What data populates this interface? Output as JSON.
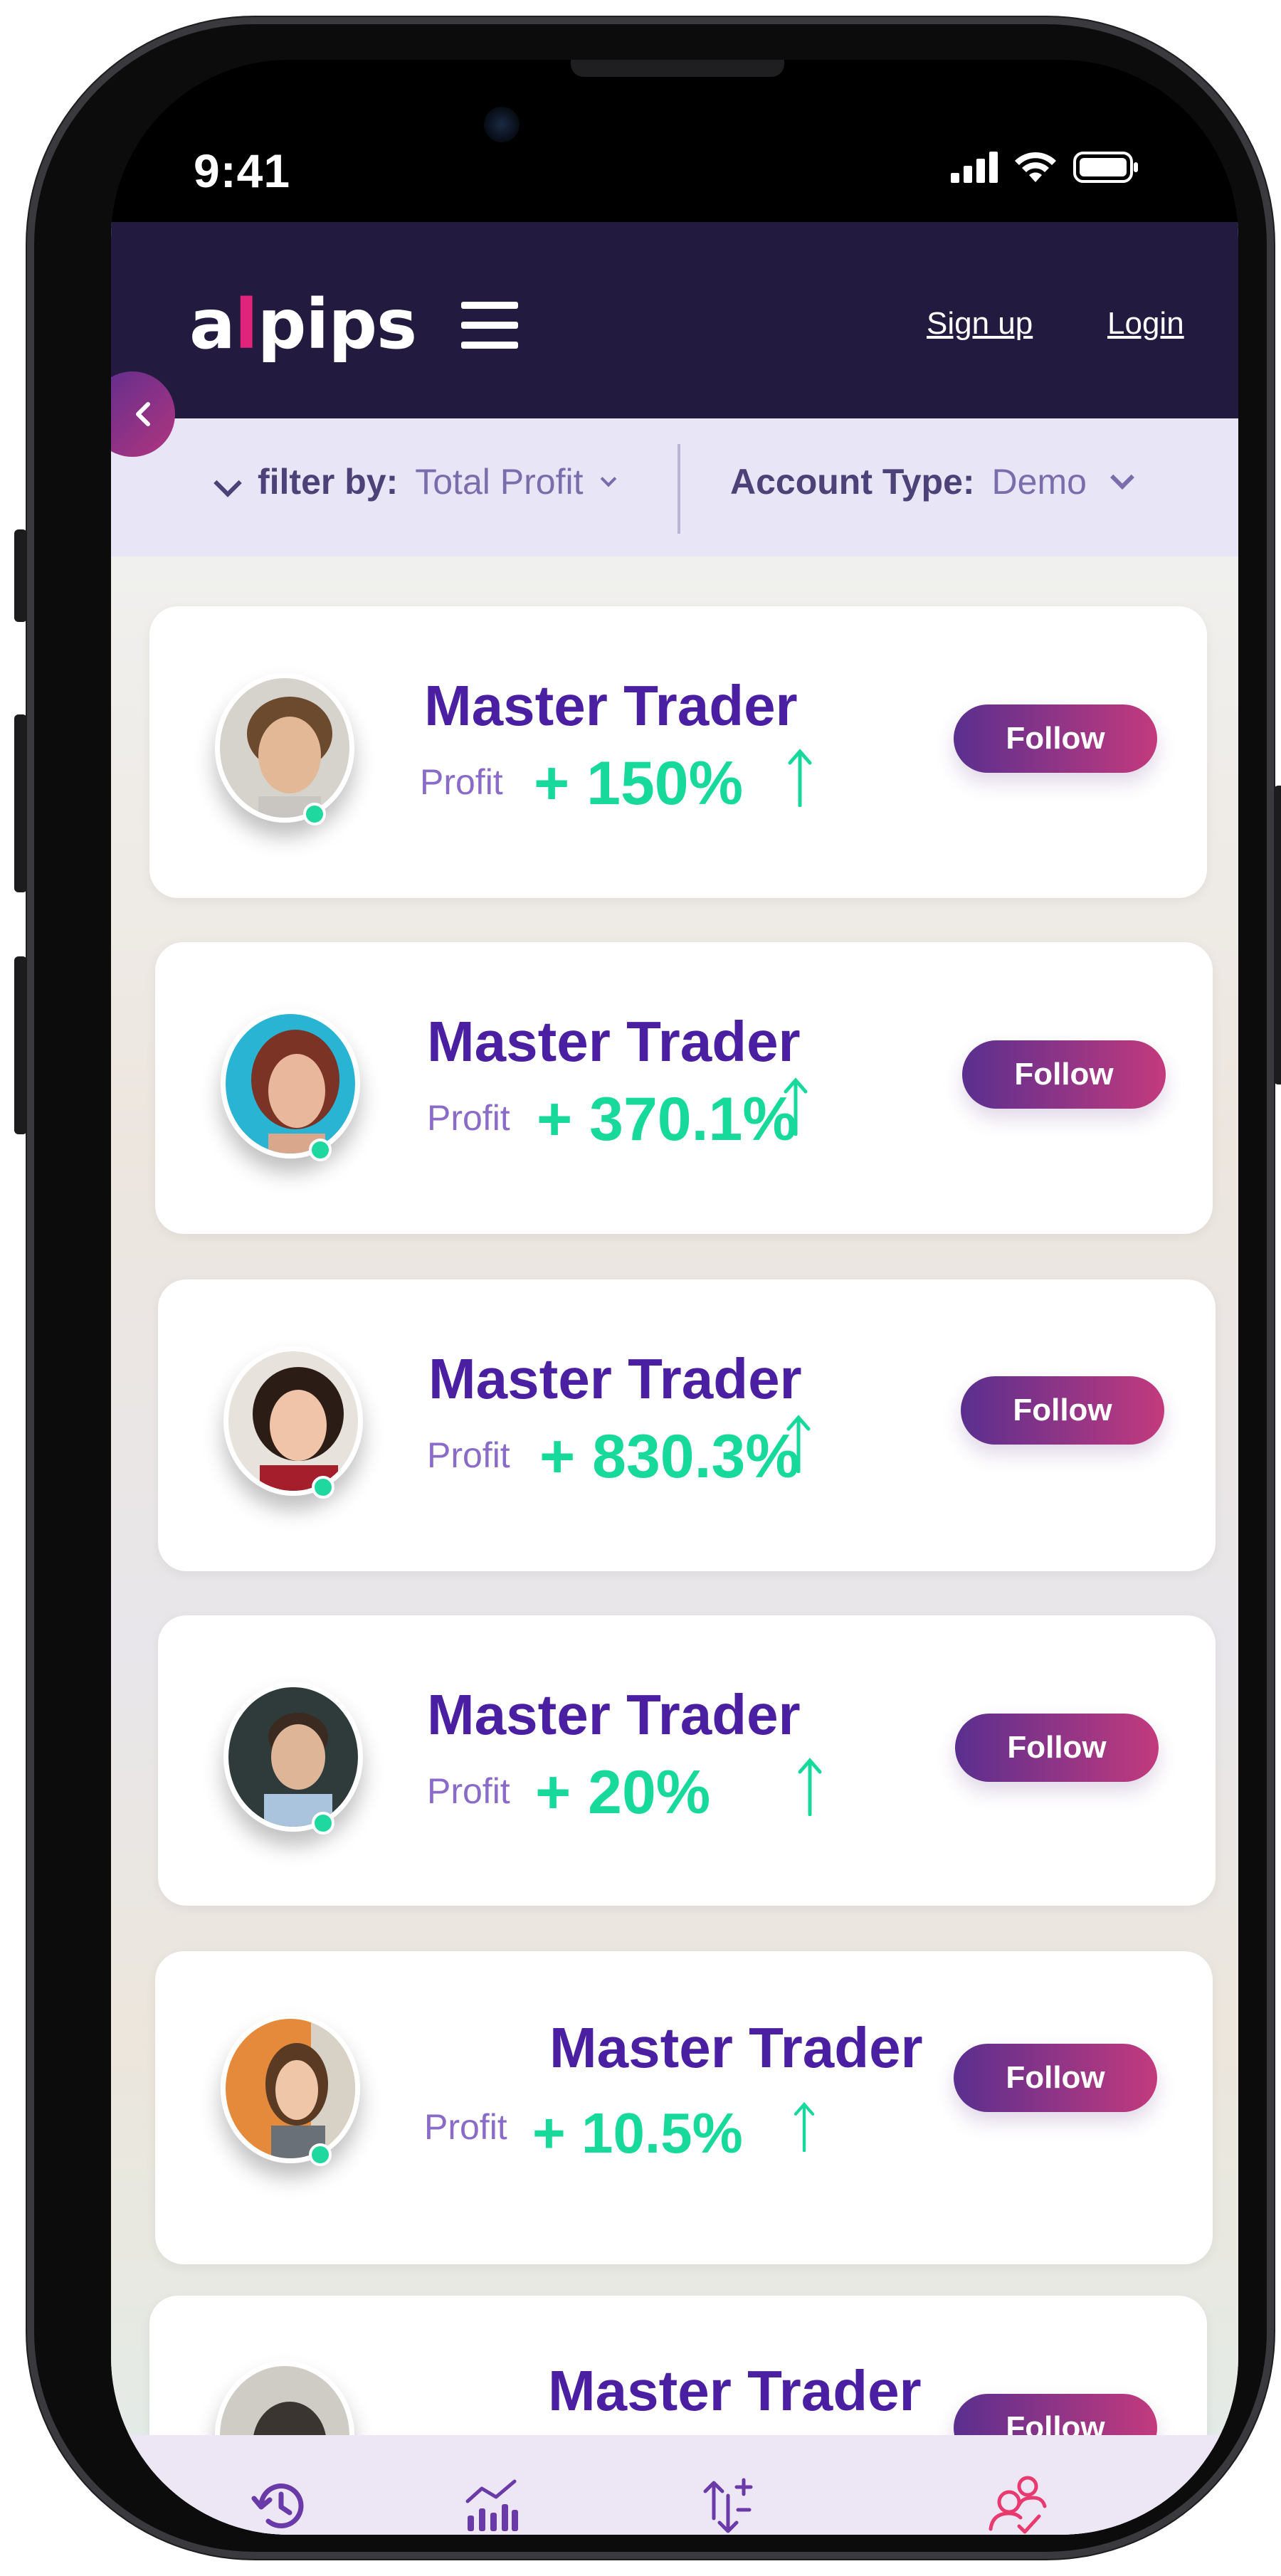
{
  "status_bar": {
    "time": "9:41"
  },
  "header": {
    "logo": {
      "prefix": "a",
      "bar": "l",
      "suffix": "pips"
    },
    "signup_label": "Sign up",
    "login_label": "Login"
  },
  "filter": {
    "filter_label": "filter by:",
    "filter_value": "Total Profit",
    "account_label": "Account Type:",
    "account_value": "Demo"
  },
  "traders": [
    {
      "name": "Master Trader",
      "profit_label": "Profit",
      "profit": "+ 150%",
      "follow_label": "Follow",
      "online": true
    },
    {
      "name": "Master Trader",
      "profit_label": "Profit",
      "profit": "+ 370.1%",
      "follow_label": "Follow",
      "online": true
    },
    {
      "name": "Master Trader",
      "profit_label": "Profit",
      "profit": "+ 830.3%",
      "follow_label": "Follow",
      "online": true
    },
    {
      "name": "Master Trader",
      "profit_label": "Profit",
      "profit": "+ 20%",
      "follow_label": "Follow",
      "online": true
    },
    {
      "name": "Master Trader",
      "profit_label": "Profit",
      "profit": "+ 10.5%",
      "follow_label": "Follow",
      "online": true
    },
    {
      "name": "Master Trader",
      "profit_label": "",
      "profit": "",
      "follow_label": "Follow",
      "online": false
    }
  ],
  "tabbar": {
    "tabs": [
      {
        "icon": "history-icon"
      },
      {
        "icon": "analytics-chart-icon"
      },
      {
        "icon": "trade-arrows-icon"
      },
      {
        "icon": "followers-icon",
        "active": true
      }
    ]
  },
  "colors": {
    "header_bg": "#221b3f",
    "brand_purple": "#4a1fa2",
    "profit_green": "#17d99a",
    "follow_gradient_start": "#5a2f8f",
    "follow_gradient_end": "#c33a7d",
    "active_tab": "#e83a6f"
  }
}
